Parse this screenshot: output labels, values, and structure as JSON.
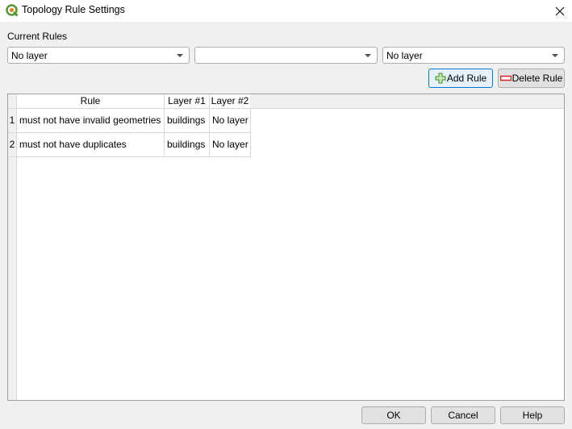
{
  "window": {
    "title": "Topology Rule Settings",
    "app_icon": "qgis-logo-icon",
    "close_icon": "close-icon"
  },
  "section_label": "Current Rules",
  "combos": [
    {
      "value": "No layer",
      "icon": "chevron-down-icon"
    },
    {
      "value": "",
      "icon": "chevron-down-icon"
    },
    {
      "value": "No layer",
      "icon": "chevron-down-icon"
    }
  ],
  "toolbar": {
    "add_rule_label": "Add Rule",
    "add_rule_icon": "add-plus-icon",
    "delete_rule_label": "Delete Rule",
    "delete_rule_icon": "remove-minus-icon"
  },
  "table": {
    "columns": [
      "Rule",
      "Layer #1",
      "Layer #2"
    ],
    "rows": [
      {
        "index": "1",
        "rule": "must not have invalid geometries",
        "layer1": "buildings",
        "layer2": "No layer"
      },
      {
        "index": "2",
        "rule": "must not have duplicates",
        "layer1": "buildings",
        "layer2": "No layer"
      }
    ]
  },
  "footer": {
    "ok_label": "OK",
    "cancel_label": "Cancel",
    "help_label": "Help"
  }
}
